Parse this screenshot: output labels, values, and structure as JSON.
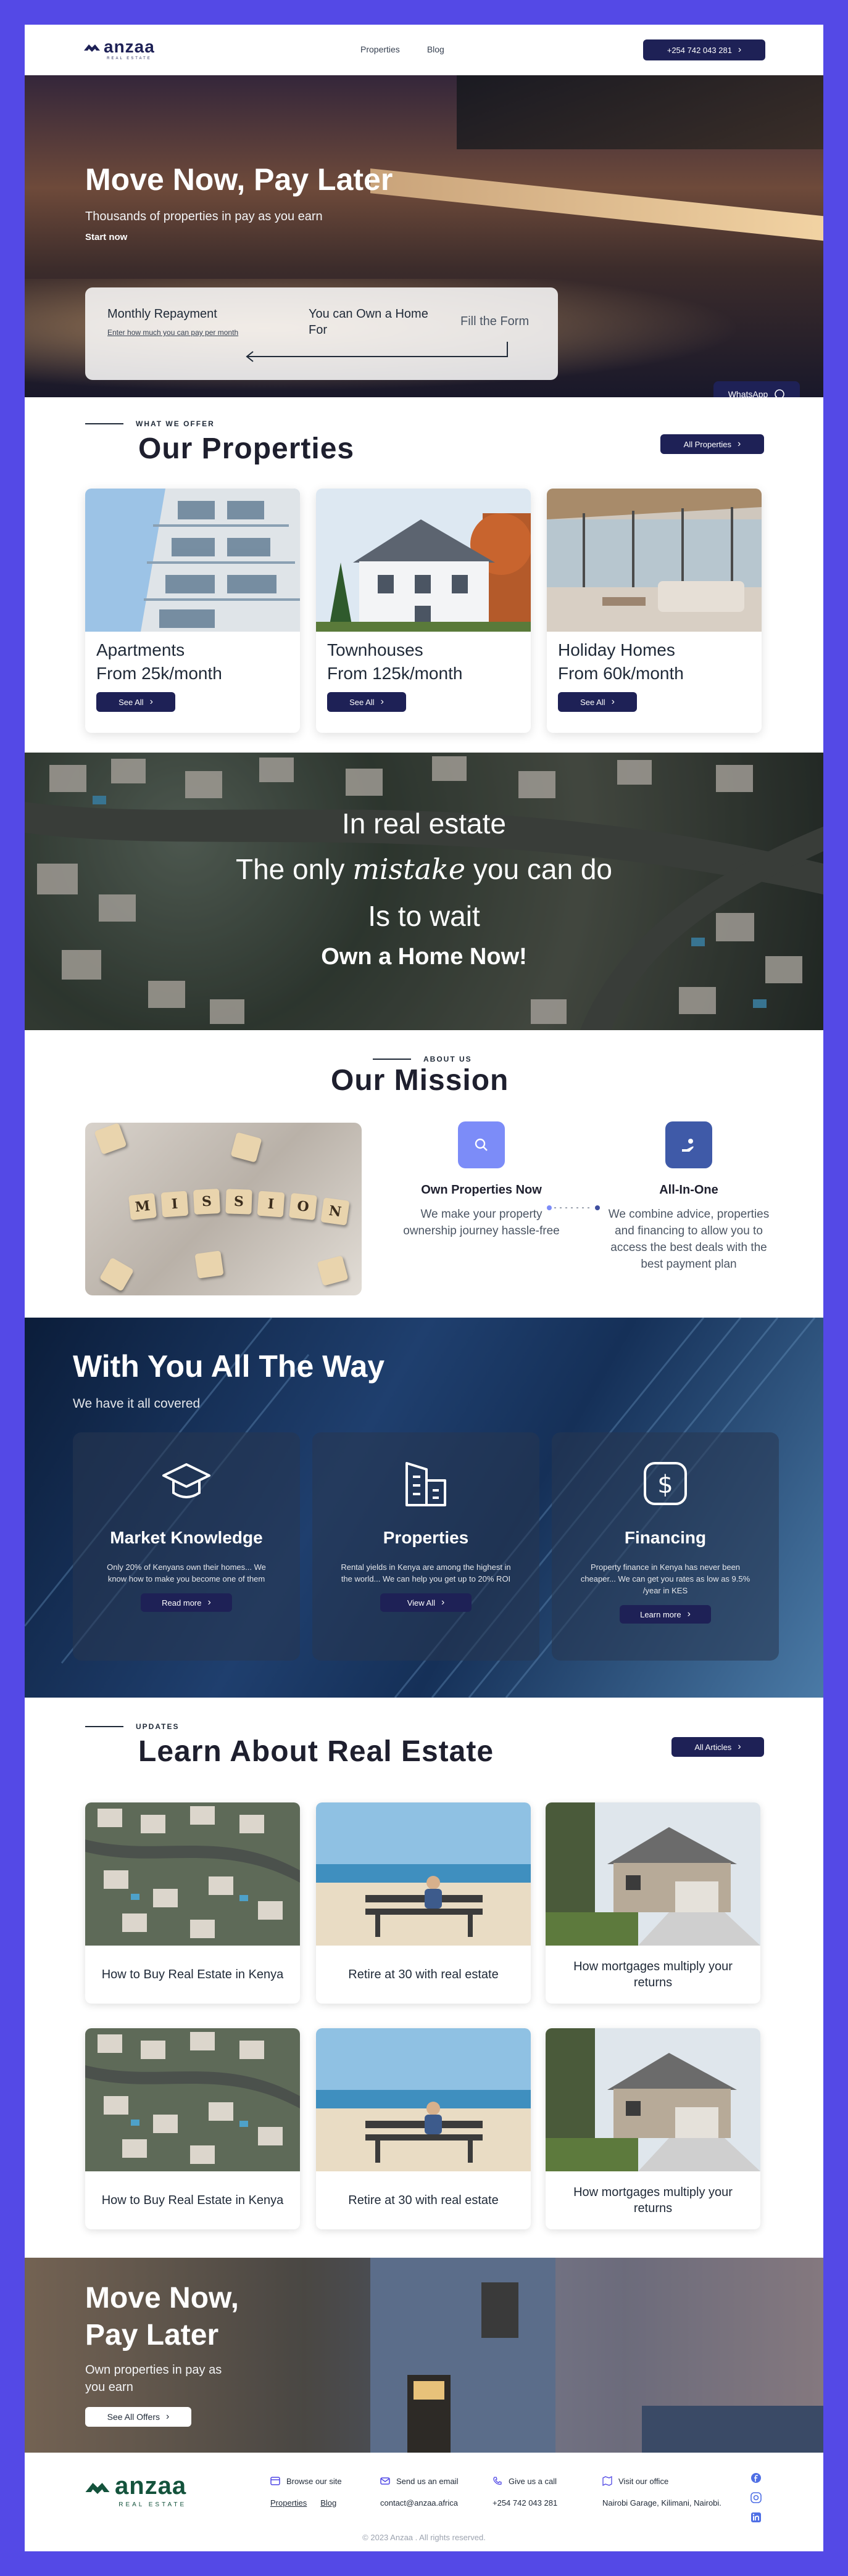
{
  "header": {
    "logo_text": "anzaa",
    "logo_sub": "REAL ESTATE",
    "nav": [
      "Properties",
      "Blog"
    ],
    "phone_label": "+254 742 043 281"
  },
  "hero": {
    "title": "Move Now, Pay Later",
    "subtitle": "Thousands of properties in pay as you earn",
    "start": "Start now",
    "card_title": "Monthly Repayment",
    "card_link": "Enter how much you can pay per month",
    "card_own": "You can Own a Home For",
    "card_fill": "Fill the Form",
    "whatsapp": "WhatsApp"
  },
  "properties": {
    "eyebrow": "WHAT WE OFFER",
    "title": "Our Properties",
    "all_label": "All Properties",
    "items": [
      {
        "name": "Apartments",
        "price": "From 25k/month",
        "button": "See All"
      },
      {
        "name": "Townhouses",
        "price": "From 125k/month",
        "button": "See All"
      },
      {
        "name": "Holiday Homes",
        "price": "From 60k/month",
        "button": "See All"
      }
    ]
  },
  "quote": {
    "line1": "In real estate",
    "line2a": "The only ",
    "line2b": "mistake",
    "line2c": " you can do",
    "line3": "Is to wait",
    "line4": "Own a Home Now!"
  },
  "mission": {
    "eyebrow": "ABOUT US",
    "title": "Our Mission",
    "image_letters": [
      "M",
      "I",
      "S",
      "S",
      "I",
      "O",
      "N"
    ],
    "cols": [
      {
        "title": "Own Properties Now",
        "text": "We make your property ownership journey hassle-free",
        "icon": "search-icon"
      },
      {
        "title": "All-In-One",
        "text": "We combine advice, properties and financing to allow you to access the best deals with the best payment plan",
        "icon": "hand-coin-icon"
      }
    ]
  },
  "withyou": {
    "title": "With You All The Way",
    "subtitle": "We have it all covered",
    "cards": [
      {
        "title": "Market Knowledge",
        "text": "Only 20% of Kenyans own their homes... We know how to make you become one of them",
        "button": "Read more",
        "icon": "graduation-cap-icon"
      },
      {
        "title": "Properties",
        "text": "Rental yields in Kenya are among the highest in the world... We can help you get up to 20% ROI",
        "button": "View All",
        "icon": "buildings-icon"
      },
      {
        "title": "Financing",
        "text": "Property finance in Kenya has never been cheaper... We can get you rates as low as 9.5% /year in KES",
        "button": "Learn more",
        "icon": "dollar-icon"
      }
    ]
  },
  "learn": {
    "eyebrow": "UPDATES",
    "title": "Learn About Real Estate",
    "all_label": "All Articles",
    "articles": [
      {
        "title": "How to Buy Real Estate in Kenya"
      },
      {
        "title": "Retire at 30 with real estate"
      },
      {
        "title": "How mortgages multiply your returns"
      },
      {
        "title": "How to Buy Real Estate in Kenya"
      },
      {
        "title": "Retire at 30 with real estate"
      },
      {
        "title": "How mortgages multiply your returns"
      }
    ]
  },
  "cta": {
    "title_line1": "Move Now,",
    "title_line2": "Pay Later",
    "sub_line1": "Own properties in pay as",
    "sub_line2": "you earn",
    "button": "See All Offers"
  },
  "footer": {
    "browse_head": "Browse our site",
    "browse_links": [
      "Properties",
      "Blog"
    ],
    "email_head": "Send us an email",
    "email": "contact@anzaa.africa",
    "call_head": "Give us a call",
    "phone": "+254 742 043 281",
    "visit_head": "Visit our office",
    "address": "Nairobi Garage, Kilimani, Nairobi.",
    "copyright": "© 2023 Anzaa . All rights reserved.",
    "social": [
      "facebook-icon",
      "instagram-icon",
      "linkedin-icon"
    ]
  },
  "colors": {
    "brand": "#1e2156",
    "frame": "#5449e6",
    "accent_light": "#7c8cf8"
  }
}
